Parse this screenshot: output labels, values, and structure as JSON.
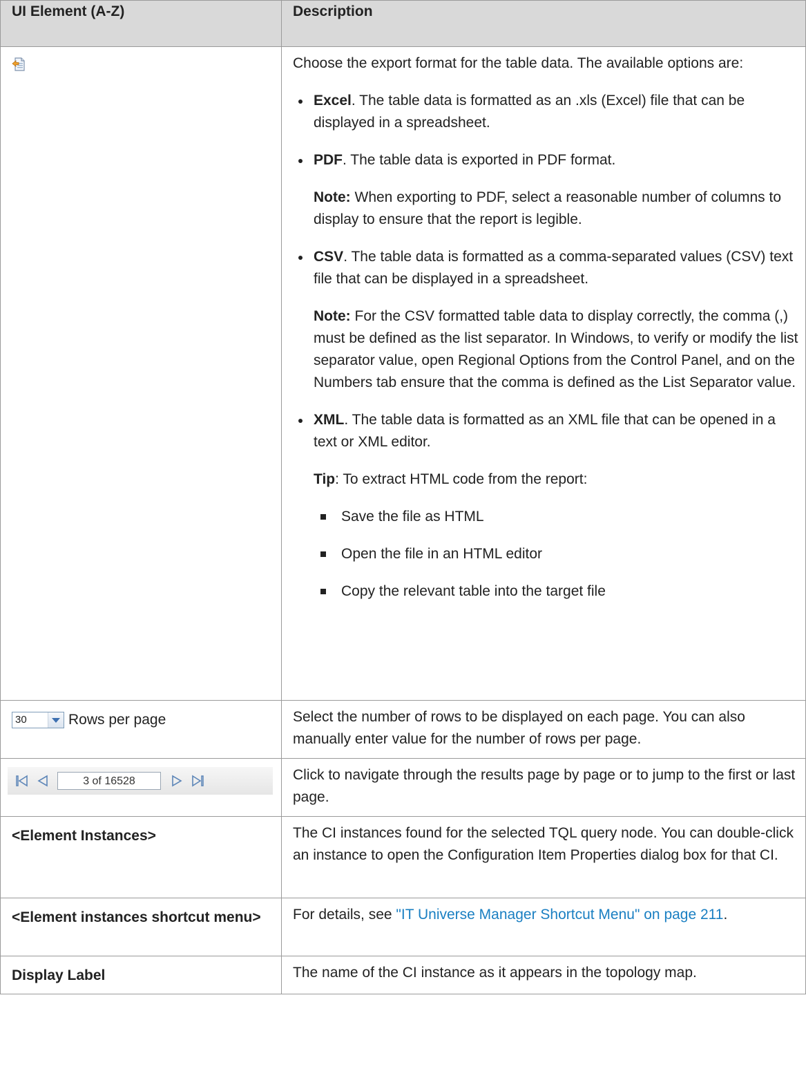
{
  "table": {
    "headers": [
      "UI Element (A-Z)",
      "Description"
    ]
  },
  "export_row": {
    "icon": "export-icon",
    "intro": "Choose the export format for the table data. The available options are:",
    "options": [
      {
        "name": "Excel",
        "text": ". The table data is formatted as an .xls (Excel) file that can be displayed in a spreadsheet."
      },
      {
        "name": "PDF",
        "text": ". The table data is exported in PDF format."
      },
      {
        "name": "CSV",
        "text": ". The table data is formatted as a comma-separated values (CSV) text file that can be displayed in a spreadsheet."
      },
      {
        "name": "XML",
        "text": ". The table data is formatted as an XML file that can be opened in a text or XML editor."
      }
    ],
    "pdf_note_label": "Note:",
    "pdf_note_text": " When exporting to PDF, select a reasonable number of columns to display to ensure that the report is legible.",
    "csv_note_label": "Note:",
    "csv_note_text": " For the CSV formatted table data to display correctly, the comma (,) must be defined as the list separator. In Windows, to verify or modify the list separator value, open Regional Options from the Control Panel, and on the Numbers tab ensure that the comma is defined as the List Separator value.",
    "tip_label": "Tip",
    "tip_text": ": To extract HTML code from the report:",
    "tip_steps": [
      "Save the file as HTML",
      "Open the file in an HTML editor",
      "Copy the relevant table into the target file"
    ]
  },
  "rows_per_page_row": {
    "select_value": "30",
    "label": "Rows per page",
    "description": "Select the number of rows to be displayed on each page. You can also manually enter value for the number of rows per page."
  },
  "pager_row": {
    "field_value": "3 of 16528",
    "description": "Click to navigate through the results page by page or to jump to the first or last page."
  },
  "element_instances_row": {
    "name": "<Element Instances>",
    "description": "The CI instances found for the selected TQL query node. You can double-click an instance to open the Configuration Item Properties dialog box for that CI."
  },
  "shortcut_menu_row": {
    "name": "<Element instances shortcut menu>",
    "prefix": "For details, see ",
    "link": "\"IT Universe Manager Shortcut Menu\" on page 211",
    "suffix": "."
  },
  "display_label_row": {
    "name": "Display Label",
    "description": "The name of the CI instance as it appears in the topology map."
  },
  "colors": {
    "header_bg": "#d9d9d9",
    "border": "#9a9a9a",
    "link": "#1a7fc2"
  }
}
